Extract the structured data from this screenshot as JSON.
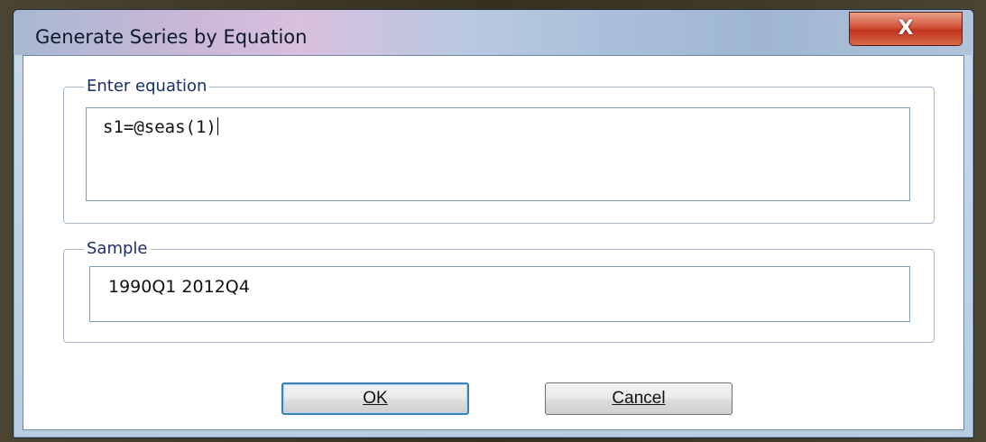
{
  "dialog": {
    "title": "Generate Series by Equation",
    "close_symbol": "X"
  },
  "equation_group": {
    "legend": "Enter equation",
    "value": "s1=@seas(1)"
  },
  "sample_group": {
    "legend": "Sample",
    "value": "1990Q1 2012Q4"
  },
  "buttons": {
    "ok_label": "OK",
    "cancel_label": "Cancel"
  },
  "colors": {
    "accent": "#3c7fb1",
    "close_red": "#c0341c",
    "legend_text": "#1a2f6b"
  },
  "icons": {
    "close": "close-icon"
  }
}
